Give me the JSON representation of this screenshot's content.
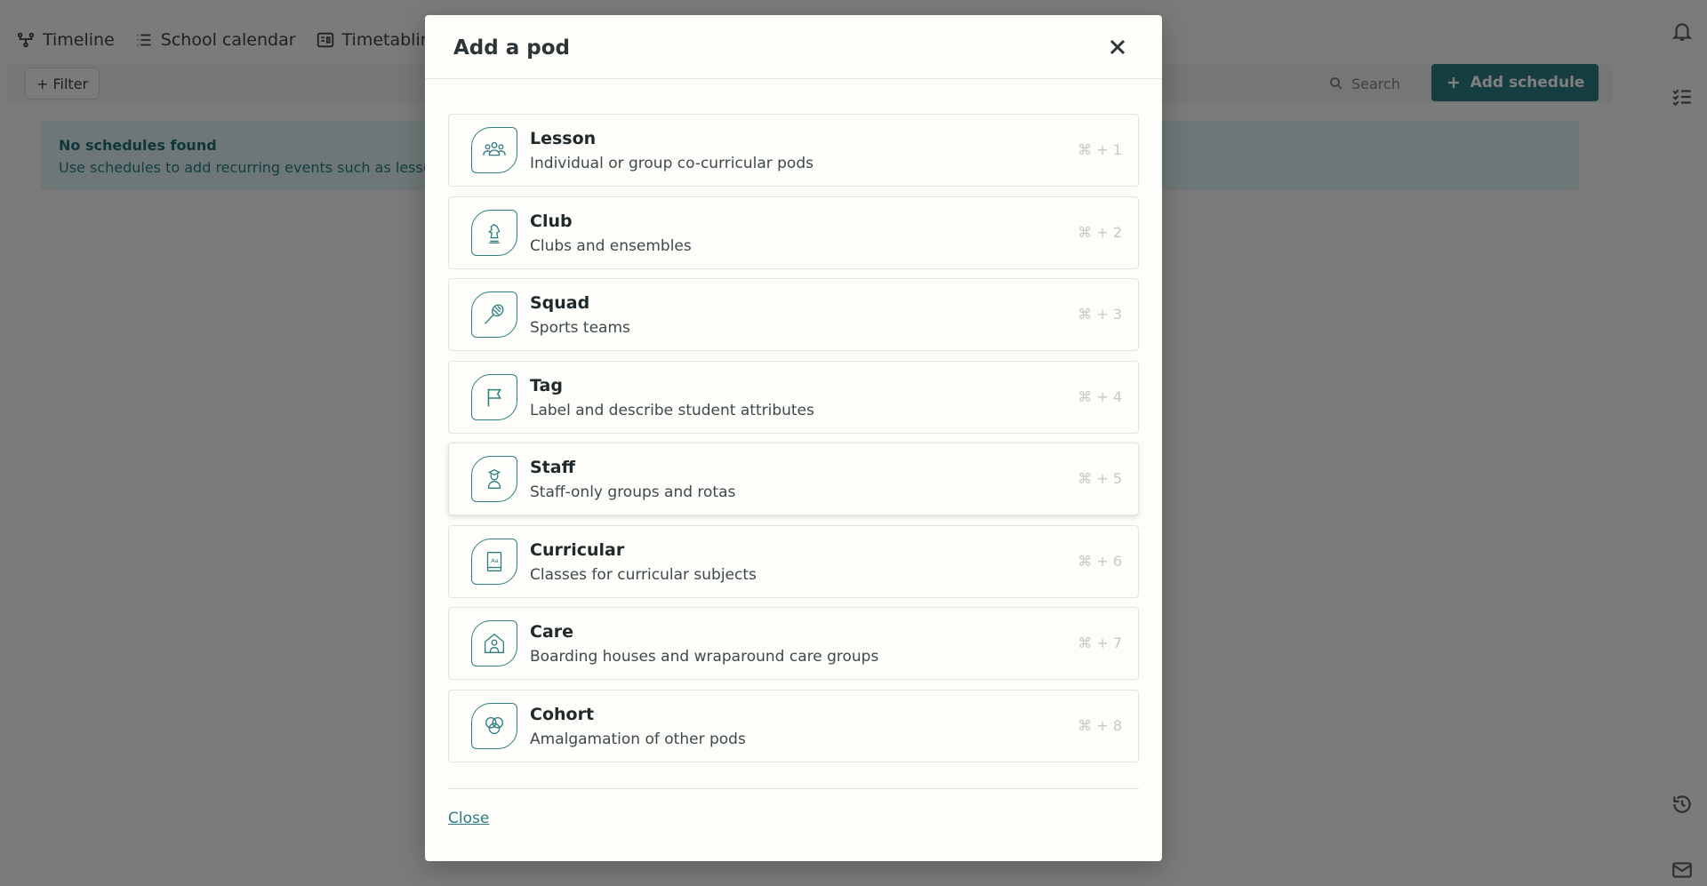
{
  "colors": {
    "accent": "#2d7d82",
    "banner_bg": "#dceeee"
  },
  "background": {
    "nav": {
      "timeline": "Timeline",
      "school_calendar": "School calendar",
      "timetabling": "Timetabling"
    },
    "toolbar": {
      "filter": "+ Filter",
      "search": "Search",
      "add_schedule": "Add schedule"
    },
    "empty": {
      "title": "No schedules found",
      "text": "Use schedules to add recurring events such as lessons."
    }
  },
  "modal": {
    "title": "Add a pod",
    "close_link": "Close",
    "pods": [
      {
        "name": "Lesson",
        "description": "Individual or group co-curricular pods",
        "shortcut": "⌘ + 1",
        "icon": "group-icon"
      },
      {
        "name": "Club",
        "description": "Clubs and ensembles",
        "shortcut": "⌘ + 2",
        "icon": "chess-knight-icon"
      },
      {
        "name": "Squad",
        "description": "Sports teams",
        "shortcut": "⌘ + 3",
        "icon": "racket-icon"
      },
      {
        "name": "Tag",
        "description": "Label and describe student attributes",
        "shortcut": "⌘ + 4",
        "icon": "flag-icon"
      },
      {
        "name": "Staff",
        "description": "Staff-only groups and rotas",
        "shortcut": "⌘ + 5",
        "icon": "teacher-icon"
      },
      {
        "name": "Curricular",
        "description": "Classes for curricular subjects",
        "shortcut": "⌘ + 6",
        "icon": "book-icon"
      },
      {
        "name": "Care",
        "description": "Boarding houses and wraparound care groups",
        "shortcut": "⌘ + 7",
        "icon": "house-person-icon"
      },
      {
        "name": "Cohort",
        "description": "Amalgamation of other pods",
        "shortcut": "⌘ + 8",
        "icon": "venn-icon"
      }
    ]
  }
}
